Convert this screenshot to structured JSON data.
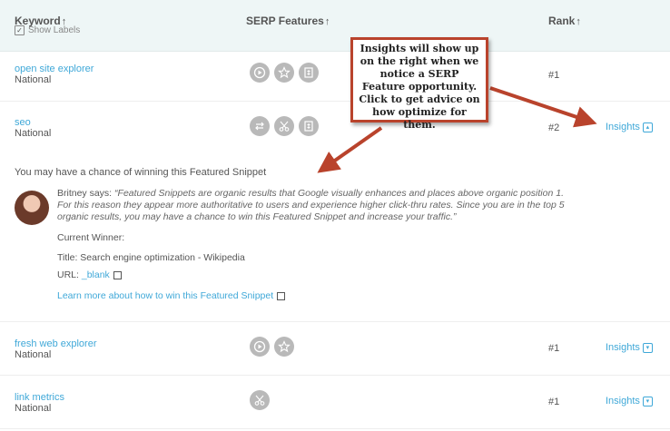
{
  "header": {
    "keyword_label": "Keyword",
    "show_labels": "Show Labels",
    "serp_label": "SERP Features",
    "rank_label": "Rank"
  },
  "rows": [
    {
      "keyword": "open site explorer",
      "location": "National",
      "rank": "#1",
      "insights": ""
    },
    {
      "keyword": "seo",
      "location": "National",
      "rank": "#2",
      "insights": "Insights"
    },
    {
      "keyword": "fresh web explorer",
      "location": "National",
      "rank": "#1",
      "insights": "Insights"
    },
    {
      "keyword": "link metrics",
      "location": "National",
      "rank": "#1",
      "insights": "Insights"
    }
  ],
  "insight_panel": {
    "chance": "You may have a chance of winning this Featured Snippet",
    "author": "Britney says:",
    "quote": "“Featured Snippets are organic results that Google visually enhances and places above organic position 1. For this reason they appear more authoritative to users and experience higher click-thru rates. Since you are in the top 5 organic results, you may have a chance to win this Featured Snippet and increase your traffic.”",
    "current_winner": "Current Winner:",
    "title_label": "Title:",
    "title_value": "Search engine optimization - Wikipedia",
    "url_label": "URL:",
    "url_value": "_blank",
    "learn_more": "Learn more about how to win this Featured Snippet"
  },
  "callout": {
    "text": "Insights will show up on the right when we notice a SERP Feature opportunity. Click to get advice on how optimize for them.",
    "color": "#b9432c"
  },
  "icons": {
    "row1": [
      "video-icon",
      "star-icon",
      "document-icon"
    ],
    "row2": [
      "exchange-icon",
      "scissors-icon",
      "document-icon"
    ],
    "row3": [
      "video-icon",
      "star-icon"
    ],
    "row4": [
      "scissors-icon"
    ]
  },
  "colors": {
    "link": "#3fa8d8",
    "header_bg": "#eef6f6",
    "feature_icon": "#b9b9b9"
  }
}
